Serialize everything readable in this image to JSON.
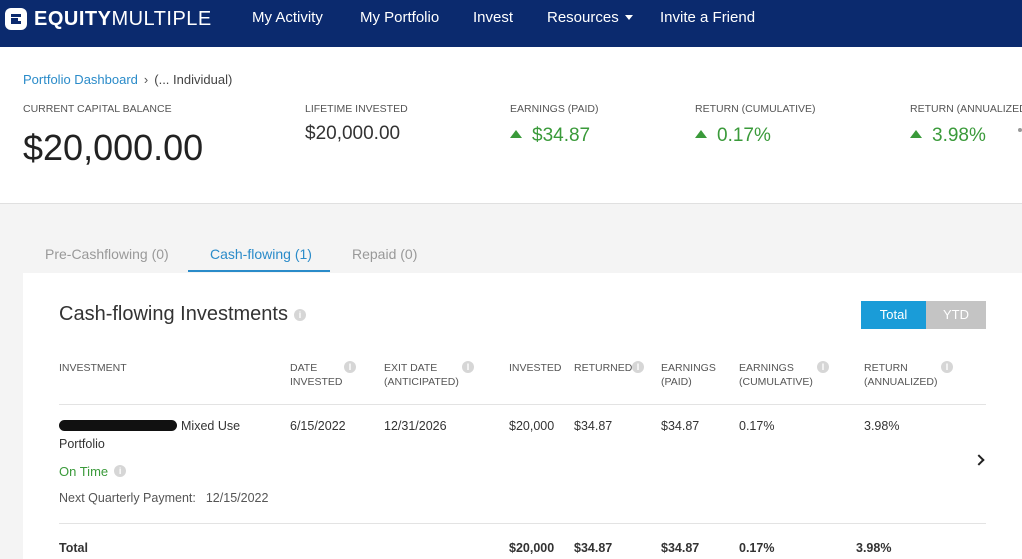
{
  "nav": {
    "brand_bold": "EQUITY",
    "brand_rest": "MULTIPLE",
    "links": [
      "My Activity",
      "My Portfolio",
      "Invest",
      "Resources",
      "Invite a Friend"
    ]
  },
  "breadcrumb": {
    "root": "Portfolio Dashboard",
    "separator": "›",
    "current": "(...   Individual)"
  },
  "summary": {
    "capital_label": "CURRENT CAPITAL BALANCE",
    "capital_value": "$20,000.00",
    "lifetime_label": "LIFETIME INVESTED",
    "lifetime_value": "$20,000.00",
    "earnings_label": "EARNINGS (PAID)",
    "earnings_value": "$34.87",
    "return_cum_label": "RETURN (CUMULATIVE)",
    "return_cum_value": "0.17%",
    "return_ann_label": "RETURN (ANNUALIZED)",
    "return_ann_value": "3.98%"
  },
  "tabs": [
    "Pre-Cashflowing (0)",
    "Cash-flowing (1)",
    "Repaid (0)"
  ],
  "card": {
    "title": "Cash-flowing Investments",
    "toggle_total": "Total",
    "toggle_ytd": "YTD",
    "headers": {
      "investment": "INVESTMENT",
      "date_invested": [
        "DATE",
        "INVESTED"
      ],
      "exit_date": [
        "EXIT DATE",
        "(ANTICIPATED)"
      ],
      "invested": "INVESTED",
      "returned": "RETURNED",
      "earnings_paid": [
        "EARNINGS",
        "(PAID)"
      ],
      "earnings_cum": [
        "EARNINGS",
        "(CUMULATIVE)"
      ],
      "return_ann": [
        "RETURN",
        "(ANNUALIZED)"
      ]
    },
    "row": {
      "name_visible": "Mixed Use",
      "name_line2": "Portfolio",
      "date_invested": "6/15/2022",
      "exit_date": "12/31/2026",
      "invested": "$20,000",
      "returned": "$34.87",
      "earnings_paid": "$34.87",
      "earnings_cum": "0.17%",
      "return_ann": "3.98%",
      "status": "On Time",
      "next_label": "Next Quarterly Payment:",
      "next_date": "12/15/2022"
    },
    "total": {
      "label": "Total",
      "invested": "$20,000",
      "returned": "$34.87",
      "earnings_paid": "$34.87",
      "earnings_cum": "0.17%",
      "return_ann": "3.98%"
    }
  },
  "colors": {
    "nav_bg": "#0b2a6e",
    "accent": "#2a8bc9",
    "positive": "#3a9a3a",
    "toggle_active": "#1a9cd8"
  }
}
